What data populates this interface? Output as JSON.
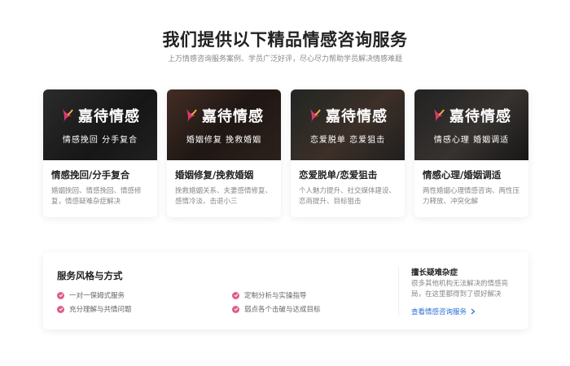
{
  "header": {
    "title": "我们提供以下精品情感咨询服务",
    "subtitle": "上万情感咨询服务案例、学员广泛好评，尽心尽力帮助学员解决情感难题"
  },
  "brand": {
    "name": "嘉待情感"
  },
  "cards": [
    {
      "caption": "情感挽回 分手复合",
      "title": "情感挽回/分手复合",
      "desc": "婚姻挽回、情感挽回、情感修复，情感疑难杂症解决"
    },
    {
      "caption": "婚姻修复 挽救婚姻",
      "title": "婚姻修复/挽救婚姻",
      "desc": "挽救婚姻关系、夫妻感情修复、感情冷淡、击退小三"
    },
    {
      "caption": "恋爱脱单 恋爱狙击",
      "title": "恋爱脱单/恋爱狙击",
      "desc": "个人魅力提升、社交媒体建设、恋商提升、目标狙击"
    },
    {
      "caption": "情感心理 婚姻调适",
      "title": "情感心理/婚姻调适",
      "desc": "两性婚姻心理情感咨询、两性压力释放、冲突化解"
    }
  ],
  "service_style": {
    "title": "服务风格与方式",
    "features": [
      "一对一保姆式服务",
      "定制分析与实操指导",
      "充分理解与共情问题",
      "弱点各个击破与达成目标"
    ]
  },
  "side": {
    "title": "擅长疑难杂症",
    "desc": "很多其他机构无法解决的情感亮局，在这里都得到了很好解决",
    "link": "查看情感咨询服务"
  },
  "colors": {
    "accent": "#e05c8b",
    "link": "#2a6fd6"
  }
}
